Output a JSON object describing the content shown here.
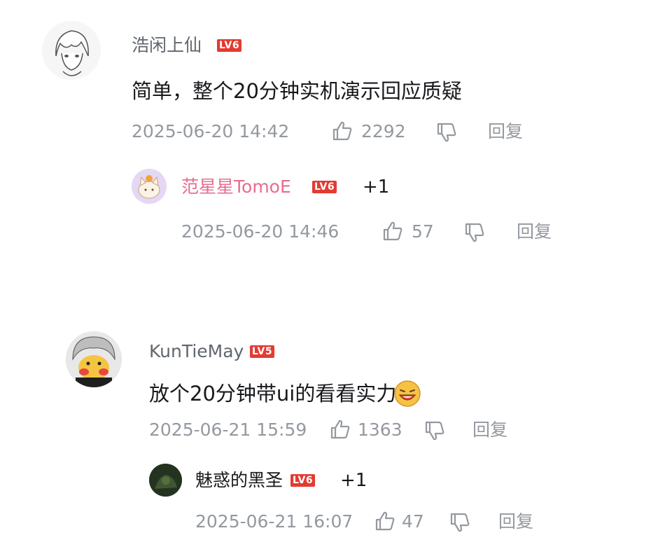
{
  "comments": [
    {
      "user": "浩闲上仙",
      "level": "LV6",
      "content": "简单，整个20分钟实机演示回应质疑",
      "time": "2025-06-20 14:42",
      "likes": "2292",
      "reply_label": "回复",
      "sub": {
        "user": "范星星TomoE",
        "level": "LV6",
        "plus": "+1",
        "time": "2025-06-20 14:46",
        "likes": "57",
        "reply_label": "回复"
      }
    },
    {
      "user": "KunTieMay",
      "level": "LV5",
      "content": "放个20分钟带ui的看看实力",
      "time": "2025-06-21 15:59",
      "likes": "1363",
      "reply_label": "回复",
      "sub": {
        "user": "魅惑的黑圣",
        "level": "LV6",
        "plus": "+1",
        "time": "2025-06-21 16:07",
        "likes": "47",
        "reply_label": "回复"
      }
    }
  ],
  "colors": {
    "level_badge": "#e33b32",
    "pink_name": "#e66d8f",
    "meta_grey": "#9499a0"
  },
  "icons": [
    "thumb-up-icon",
    "thumb-down-icon",
    "laugh-emoji-icon"
  ]
}
